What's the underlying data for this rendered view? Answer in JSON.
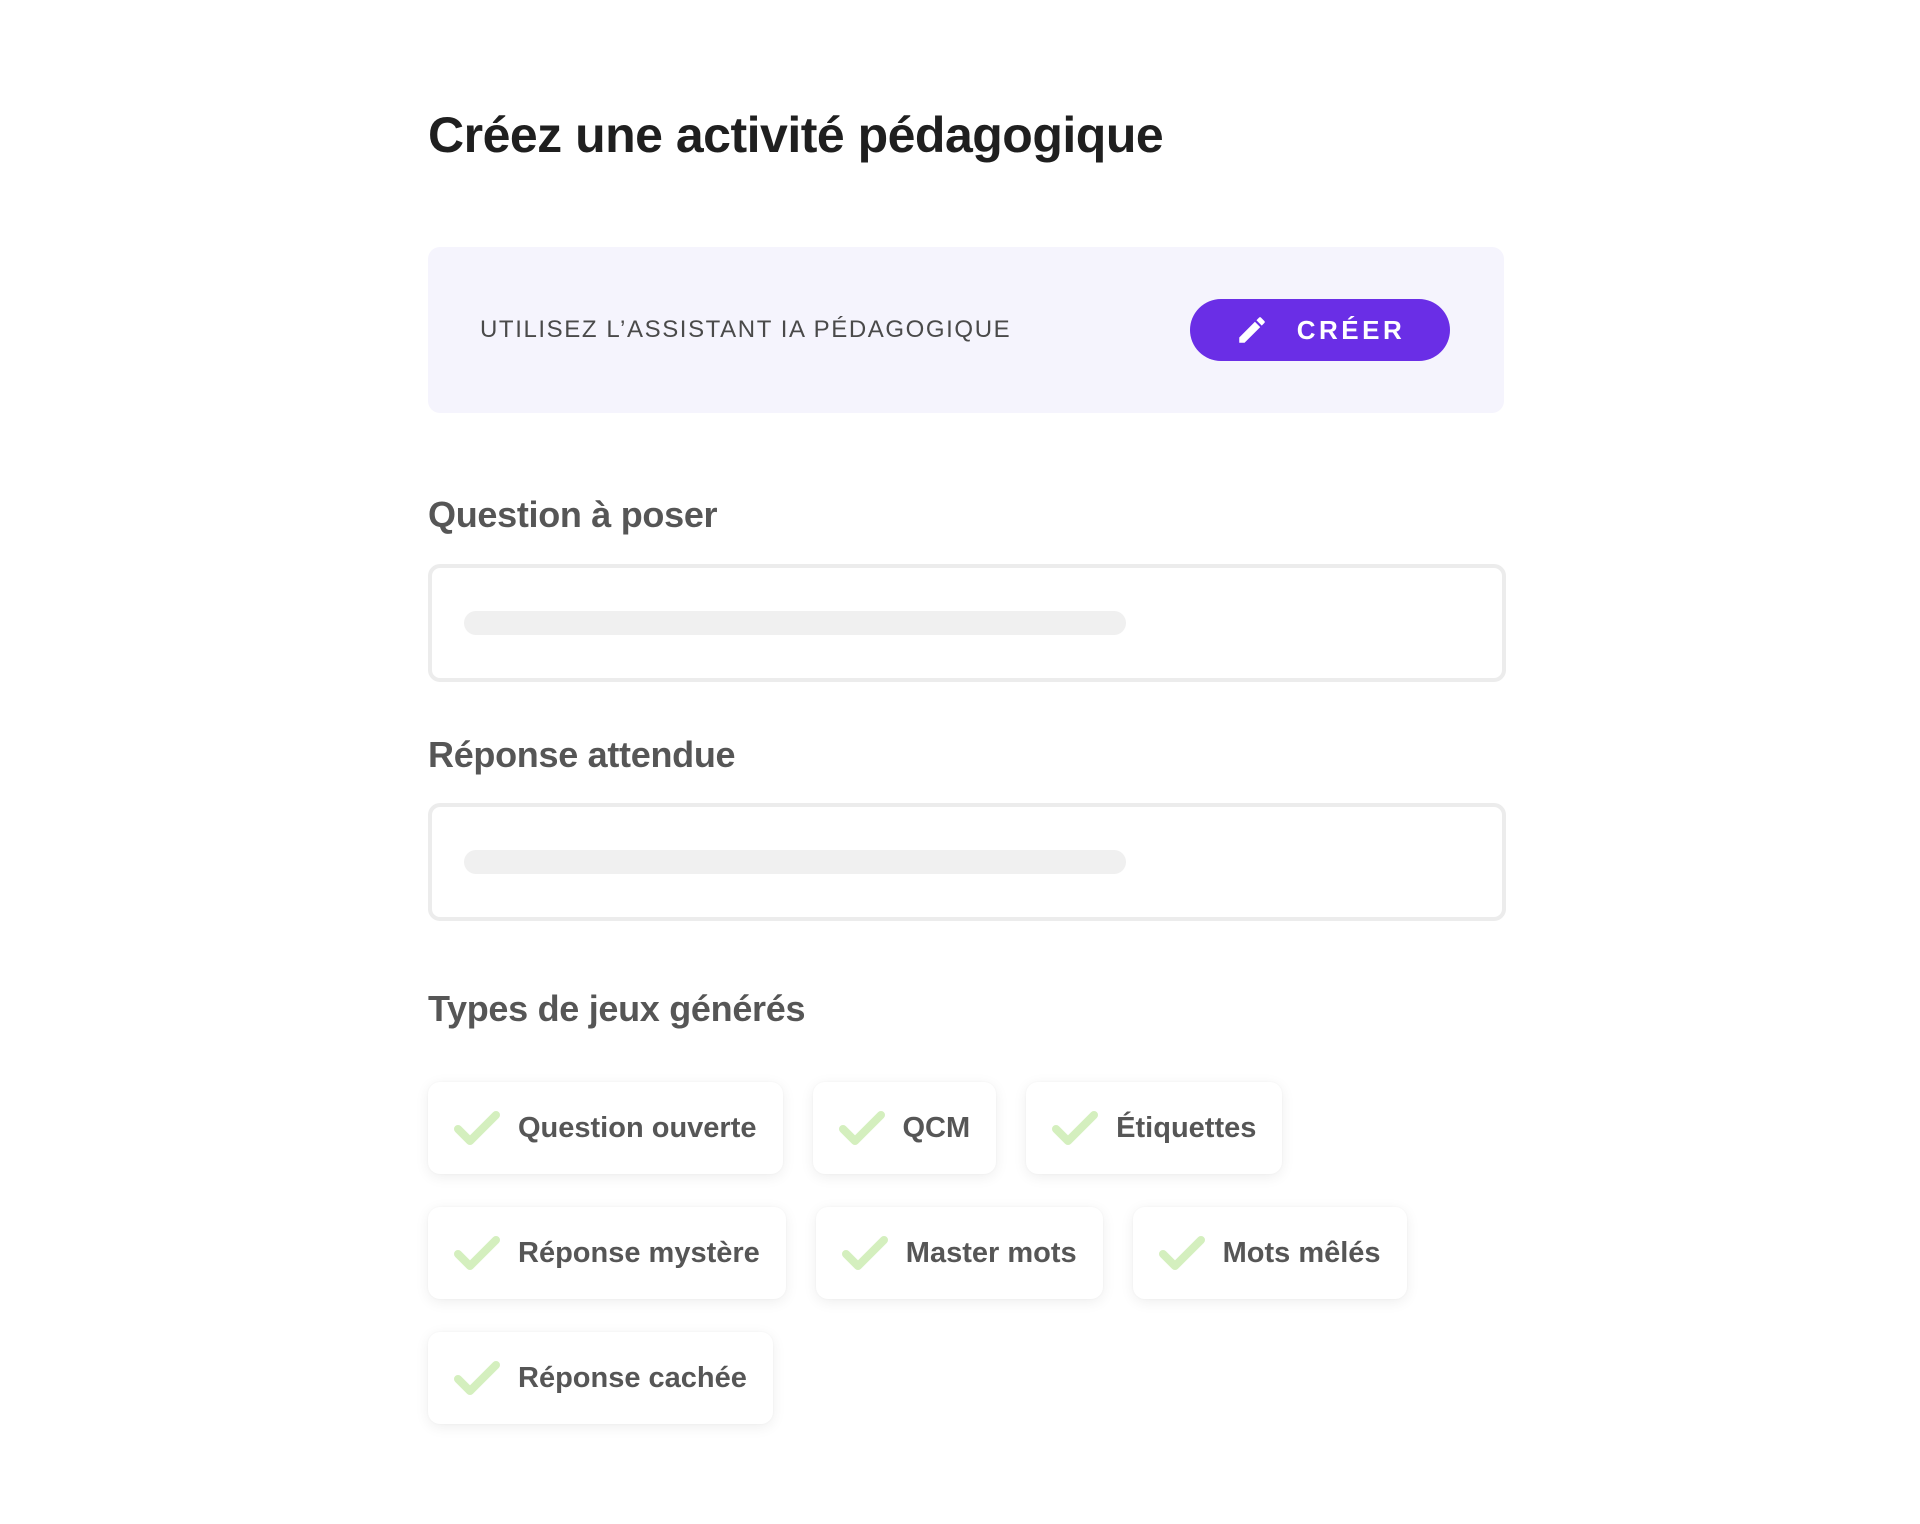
{
  "page": {
    "title": "Créez une activité pédagogique"
  },
  "assistant": {
    "label": "UTILISEZ L’ASSISTANT IA PÉDAGOGIQUE",
    "button_label": "CRÉER",
    "button_icon": "pencil-icon",
    "accent_color": "#6a2ee6",
    "panel_color": "#f5f4fd"
  },
  "question_field": {
    "label": "Question à poser",
    "value": ""
  },
  "answer_field": {
    "label": "Réponse attendue",
    "value": ""
  },
  "game_types": {
    "title": "Types de jeux générés",
    "check_icon": "checkmark-icon",
    "check_color": "#d4efbe",
    "rows": [
      [
        {
          "label": "Question ouverte",
          "checked": true
        },
        {
          "label": "QCM",
          "checked": true
        },
        {
          "label": "Étiquettes",
          "checked": true
        }
      ],
      [
        {
          "label": "Réponse mystère",
          "checked": true
        },
        {
          "label": "Master mots",
          "checked": true
        },
        {
          "label": "Mots mêlés",
          "checked": true
        }
      ],
      [
        {
          "label": "Réponse cachée",
          "checked": true
        }
      ]
    ]
  }
}
